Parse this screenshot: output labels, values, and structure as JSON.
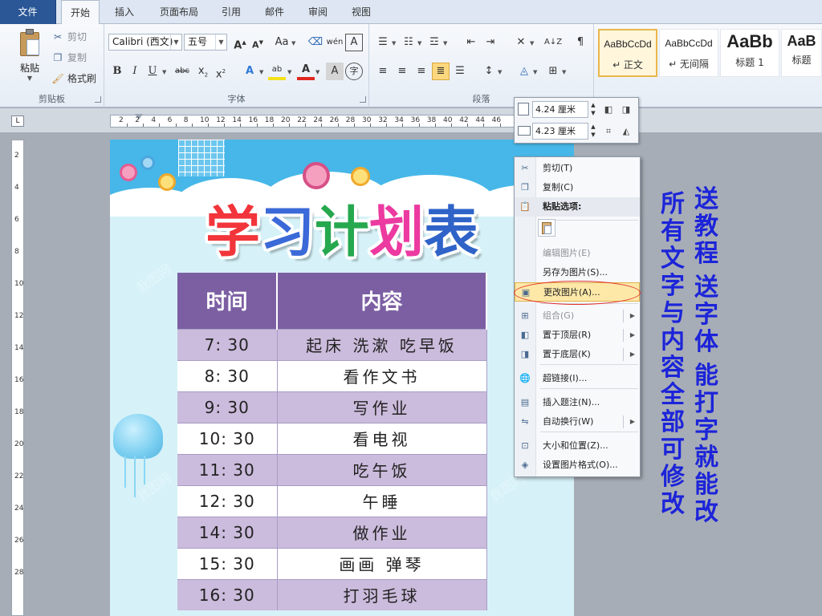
{
  "tabs": [
    "文件",
    "开始",
    "插入",
    "页面布局",
    "引用",
    "邮件",
    "审阅",
    "视图"
  ],
  "clipboard": {
    "paste": "粘贴",
    "cut": "剪切",
    "copy": "复制",
    "format_painter": "格式刷",
    "group": "剪贴板"
  },
  "font": {
    "name": "Calibri (西文)",
    "size": "五号",
    "group": "字体"
  },
  "paragraph": {
    "group": "段落"
  },
  "styles": [
    {
      "sample": "AaBbCcDd",
      "name": "↵ 正文"
    },
    {
      "sample": "AaBbCcDd",
      "name": "↵ 无间隔"
    },
    {
      "sample": "AaBb",
      "name": "标题 1"
    },
    {
      "sample": "AaB",
      "name": "标题"
    }
  ],
  "ruler": {
    "numbers": [
      "2",
      "2",
      "4",
      "6",
      "8",
      "10",
      "12",
      "14",
      "16",
      "18",
      "20",
      "22",
      "24",
      "26",
      "28",
      "30",
      "32",
      "34",
      "36",
      "38",
      "40",
      "42",
      "44",
      "46"
    ],
    "vnumbers": [
      "2",
      "4",
      "6",
      "8",
      "10",
      "12",
      "14",
      "16",
      "18",
      "20",
      "22",
      "24",
      "26",
      "28"
    ]
  },
  "document": {
    "title": [
      "学",
      "习",
      "计",
      "划",
      "表"
    ],
    "title_colors": [
      "#f2353b",
      "#3b69d8",
      "#26a84f",
      "#ec3aa0",
      "#2f63c8"
    ],
    "table": {
      "headers": [
        "时间",
        "内容"
      ],
      "rows": [
        [
          "7: 30",
          "起床  洗漱  吃早饭"
        ],
        [
          "8: 30",
          "看作文书"
        ],
        [
          "9: 30",
          "写作业"
        ],
        [
          "10: 30",
          "看电视"
        ],
        [
          "11: 30",
          "吃午饭"
        ],
        [
          "12: 30",
          "午睡"
        ],
        [
          "14: 30",
          "做作业"
        ],
        [
          "15: 30",
          "画画  弹琴"
        ],
        [
          "16: 30",
          "打羽毛球"
        ]
      ]
    },
    "watermark": "我图网"
  },
  "picture_toolbar": {
    "height": "4.24 厘米",
    "width": "4.23 厘米"
  },
  "context_menu": [
    {
      "label": "剪切(T)",
      "icon": "scissors-icon",
      "glyph": "✂",
      "state": "normal"
    },
    {
      "label": "复制(C)",
      "icon": "copy-icon",
      "glyph": "❐",
      "state": "normal"
    },
    {
      "label": "粘贴选项:",
      "icon": "paste-icon",
      "glyph": "📋",
      "state": "header"
    },
    {
      "label": "编辑图片(E)",
      "icon": "",
      "glyph": "",
      "state": "disabled"
    },
    {
      "label": "另存为图片(S)...",
      "icon": "",
      "glyph": "",
      "state": "normal"
    },
    {
      "label": "更改图片(A)...",
      "icon": "change-picture-icon",
      "glyph": "▣",
      "state": "highlighted"
    },
    {
      "label": "组合(G)",
      "icon": "group-icon",
      "glyph": "⊞",
      "state": "disabled",
      "submenu": true
    },
    {
      "label": "置于顶层(R)",
      "icon": "bring-front-icon",
      "glyph": "◧",
      "state": "normal",
      "submenu": true
    },
    {
      "label": "置于底层(K)",
      "icon": "send-back-icon",
      "glyph": "◨",
      "state": "normal",
      "submenu": true
    },
    {
      "label": "超链接(I)...",
      "icon": "hyperlink-icon",
      "glyph": "🌐",
      "state": "normal"
    },
    {
      "label": "插入题注(N)...",
      "icon": "caption-icon",
      "glyph": "▤",
      "state": "normal"
    },
    {
      "label": "自动换行(W)",
      "icon": "wrap-text-icon",
      "glyph": "⇋",
      "state": "normal",
      "submenu": true
    },
    {
      "label": "大小和位置(Z)...",
      "icon": "size-position-icon",
      "glyph": "⊡",
      "state": "normal"
    },
    {
      "label": "设置图片格式(O)...",
      "icon": "format-picture-icon",
      "glyph": "◈",
      "state": "normal"
    }
  ],
  "promo": {
    "line1": "送教程 送字体 能打字就能改",
    "line2": "所有文字与内容全部可修改"
  },
  "colors": {
    "table_header": "#7c5fa3",
    "table_alt_row": "#cbbbdc",
    "promo_text": "#1c24d9",
    "highlight_oval": "#e0312b"
  }
}
